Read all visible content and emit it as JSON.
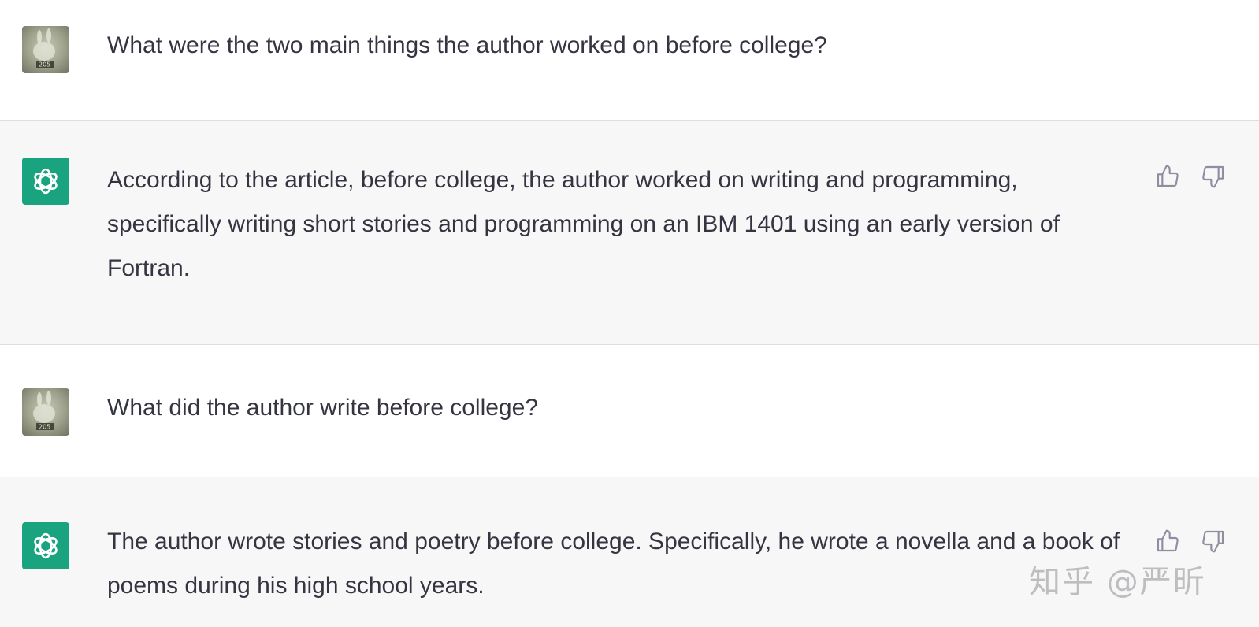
{
  "messages": [
    {
      "role": "user",
      "text": "What were the two main things the author worked on before college?"
    },
    {
      "role": "assistant",
      "text": "According to the article, before college, the author worked on writing and programming, specifically writing short stories and programming on an IBM 1401 using an early version of Fortran."
    },
    {
      "role": "user",
      "text": "What did the author write before college?"
    },
    {
      "role": "assistant",
      "text": "The author wrote stories and poetry before college. Specifically, he wrote a novella and a book of poems during his high school years."
    }
  ],
  "avatar": {
    "user_badge": "205"
  },
  "icons": {
    "like": "thumbs-up-icon",
    "dislike": "thumbs-down-icon",
    "assistant_logo": "openai-logo-icon"
  },
  "colors": {
    "assistant_avatar": "#19a37f",
    "assistant_bg": "#f7f7f8",
    "user_bg": "#ffffff",
    "text": "#343541"
  },
  "watermark": "知乎 @严昕"
}
